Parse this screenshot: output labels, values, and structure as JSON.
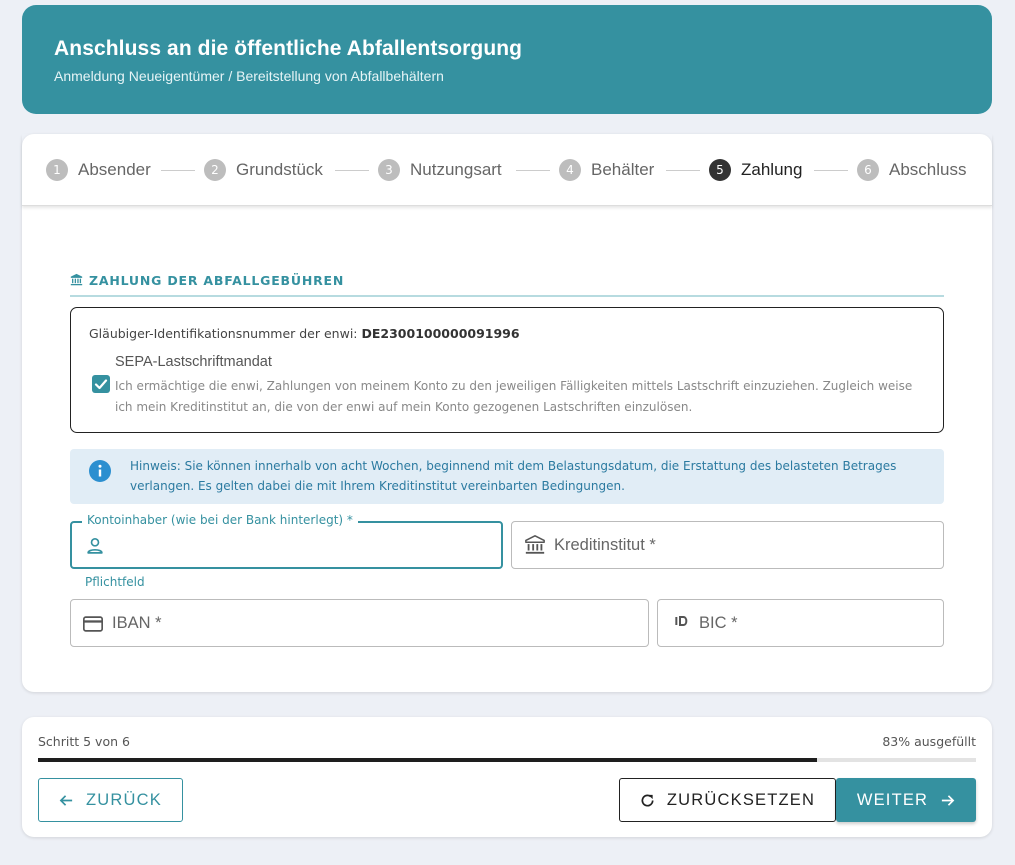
{
  "header": {
    "title": "Anschluss an die öffentliche Abfallentsorgung",
    "subtitle": "Anmeldung Neueigentümer / Bereitstellung von Abfallbehältern"
  },
  "stepper": {
    "steps": [
      {
        "num": "1",
        "label": "Absender"
      },
      {
        "num": "2",
        "label": "Grundstück"
      },
      {
        "num": "3",
        "label": "Nutzungsart"
      },
      {
        "num": "4",
        "label": "Behälter"
      },
      {
        "num": "5",
        "label": "Zahlung"
      },
      {
        "num": "6",
        "label": "Abschluss"
      }
    ],
    "active_index": 4
  },
  "section": {
    "title": "ZAHLUNG DER ABFALLGEBÜHREN",
    "icon": "bank-icon"
  },
  "mandate": {
    "creditor_label": "Gläubiger-Identifikationsnummer der enwi:",
    "creditor_id": "DE2300100000091996",
    "sepa_title": "SEPA-Lastschriftmandat",
    "checked": true,
    "text": "Ich ermächtige die enwi, Zahlungen von meinem Konto zu den jeweiligen Fälligkeiten mittels Lastschrift einzuziehen. Zugleich weise ich mein Kreditinstitut an, die von der enwi auf mein Konto gezogenen Lastschriften einzulösen."
  },
  "hint": {
    "text": "Hinweis: Sie können innerhalb von acht Wochen, beginnend mit dem Belastungsdatum, die Erstattung des belasteten Betrages verlangen. Es gelten dabei die mit Ihrem Kreditinstitut vereinbarten Bedingungen.",
    "icon": "info-icon"
  },
  "fields": {
    "account_holder": {
      "label": "Kontoinhaber (wie bei der Bank hinterlegt) *",
      "value": "",
      "helper": "Pflichtfeld",
      "icon": "person-icon"
    },
    "bank": {
      "placeholder": "Kreditinstitut *",
      "value": "",
      "icon": "bank-icon"
    },
    "iban": {
      "placeholder": "IBAN *",
      "value": "",
      "icon": "credit-card-icon"
    },
    "bic": {
      "placeholder": "BIC *",
      "value": "",
      "icon": "id-icon"
    }
  },
  "footer": {
    "step_text": "Schritt 5 von 6",
    "percent_text": "83% ausgefüllt",
    "progress": 0.83,
    "back_label": "ZURÜCK",
    "reset_label": "ZURÜCKSETZEN",
    "next_label": "WEITER"
  },
  "colors": {
    "accent": "#3591a0",
    "background": "#edf0f6",
    "hint_bg": "#e1edf6",
    "hint_text": "#2b7aa0"
  }
}
